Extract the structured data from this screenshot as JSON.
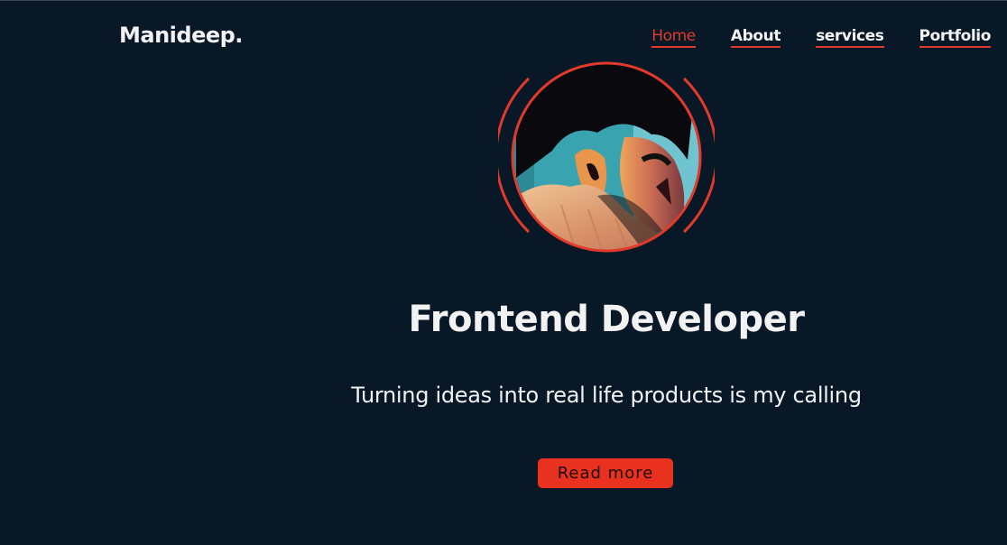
{
  "header": {
    "logo": "Manideep.",
    "nav": [
      {
        "label": "Home",
        "active": true
      },
      {
        "label": "About",
        "active": false
      },
      {
        "label": "services",
        "active": false
      },
      {
        "label": "Portfolio",
        "active": false
      }
    ]
  },
  "hero": {
    "headline": "Frontend Developer",
    "tagline": "Turning ideas into real life products is my calling",
    "cta_label": "Read more"
  },
  "colors": {
    "background": "#081827",
    "accent": "#e8311f",
    "text": "#f2f2f2"
  }
}
